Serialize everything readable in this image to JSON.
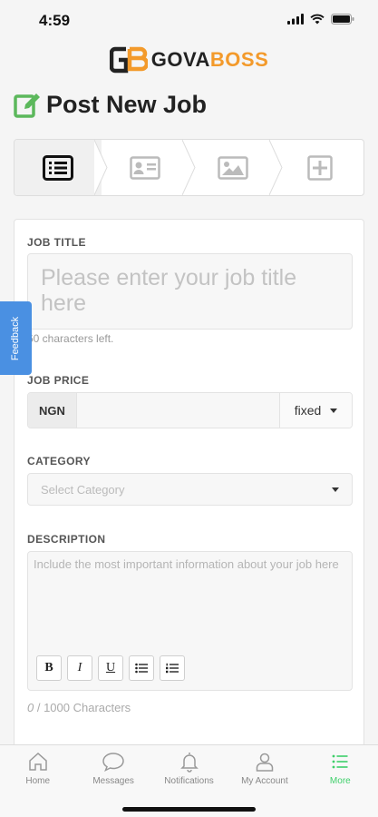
{
  "status": {
    "time": "4:59"
  },
  "brand": {
    "logo_part1": "GOVA",
    "logo_part2": "BOSS",
    "accent": "#f39a2b",
    "dark": "#222222"
  },
  "page": {
    "title": "Post New Job",
    "title_icon": "edit-icon",
    "title_icon_color": "#5cb85c"
  },
  "stepper": {
    "steps": [
      {
        "icon": "list-icon",
        "active": true
      },
      {
        "icon": "id-card-icon",
        "active": false
      },
      {
        "icon": "image-icon",
        "active": false
      },
      {
        "icon": "plus-square-icon",
        "active": false
      }
    ]
  },
  "form": {
    "job_title": {
      "label": "JOB TITLE",
      "placeholder": "Please enter your job title here",
      "chars_left": "60 characters left."
    },
    "job_price": {
      "label": "JOB PRICE",
      "currency": "NGN",
      "value": "",
      "type": "fixed"
    },
    "category": {
      "label": "CATEGORY",
      "placeholder": "Select Category"
    },
    "description": {
      "label": "DESCRIPTION",
      "placeholder": "Include the most important information about your job here",
      "toolbar": [
        "bold",
        "italic",
        "underline",
        "bullet-list",
        "numbered-list"
      ],
      "toolbar_labels": {
        "bold": "B",
        "italic": "I",
        "underline": "U"
      },
      "count_current": "0",
      "count_rest": " / 1000 Characters"
    }
  },
  "feedback": {
    "label": "Feedback",
    "color": "#4a90e2"
  },
  "tabbar": {
    "active_color": "#3ecf6a",
    "items": [
      {
        "label": "Home",
        "icon": "home-icon"
      },
      {
        "label": "Messages",
        "icon": "chat-icon"
      },
      {
        "label": "Notifications",
        "icon": "bell-icon"
      },
      {
        "label": "My Account",
        "icon": "user-icon"
      },
      {
        "label": "More",
        "icon": "menu-icon",
        "active": true
      }
    ]
  }
}
